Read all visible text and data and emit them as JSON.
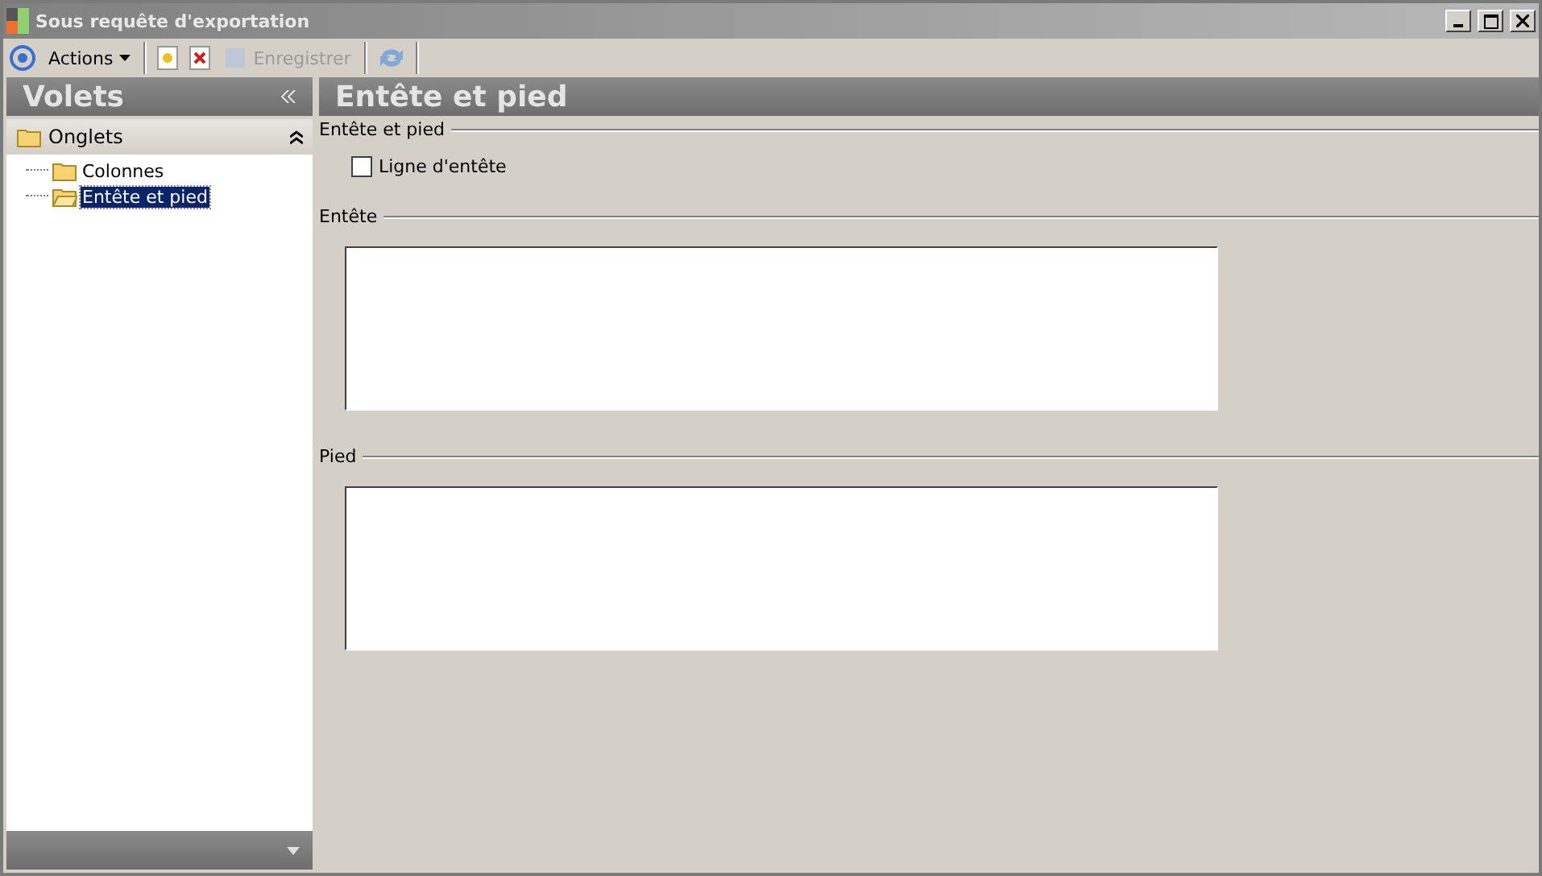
{
  "window": {
    "title": "Sous requête d'exportation"
  },
  "toolbar": {
    "actions": "Actions",
    "save": {
      "label": "Enregistrer",
      "disabled": true
    }
  },
  "sidebar": {
    "title": "Volets",
    "group": {
      "label": "Onglets",
      "expanded": true,
      "children": [
        {
          "label": "Colonnes",
          "selected": false
        },
        {
          "label": "Entête et pied",
          "selected": true
        }
      ]
    }
  },
  "panel": {
    "title": "Entête et pied",
    "section": "Entête et pied",
    "header_checkbox": {
      "label": "Ligne d'entête",
      "checked": false
    },
    "header_group": "Entête",
    "footer_group": "Pied"
  }
}
